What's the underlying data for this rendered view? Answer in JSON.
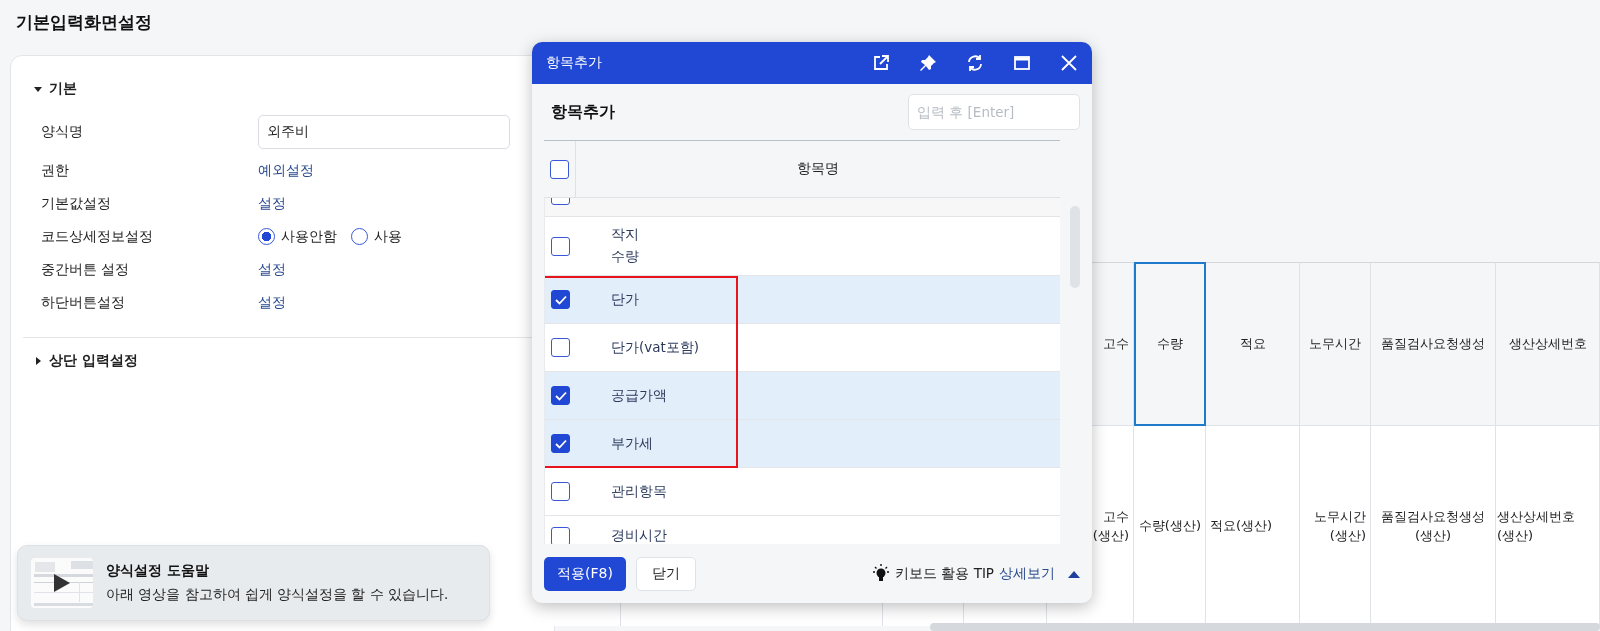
{
  "page": {
    "title": "기본입력화면설정"
  },
  "settings": {
    "sections": [
      {
        "label": "기본",
        "expanded": true,
        "rows": [
          {
            "kind": "input",
            "label": "양식명",
            "value": "외주비"
          },
          {
            "kind": "link",
            "label": "권한",
            "value": "예외설정"
          },
          {
            "kind": "link",
            "label": "기본값설정",
            "value": "설정"
          },
          {
            "kind": "radio",
            "label": "코드상세정보설정",
            "options": [
              {
                "label": "사용안함",
                "selected": true
              },
              {
                "label": "사용",
                "selected": false
              }
            ]
          },
          {
            "kind": "link",
            "label": "중간버튼 설정",
            "value": "설정"
          },
          {
            "kind": "link",
            "label": "하단버튼설정",
            "value": "설정"
          }
        ]
      },
      {
        "label": "상단 입력설정",
        "expanded": false
      }
    ]
  },
  "help": {
    "title": "양식설정 도움말",
    "text": "아래 영상을 참고하여 쉽게 양식설정을 할 수 있습니다."
  },
  "grid": {
    "columns": [
      {
        "label": "고수",
        "selected": false
      },
      {
        "label": "수량",
        "selected": true
      },
      {
        "label": "적요",
        "selected": false
      },
      {
        "label": "노무시간",
        "selected": false
      },
      {
        "label": "품질검사요청생성",
        "selected": false
      },
      {
        "label": "생산상세번호",
        "selected": false
      }
    ],
    "rows": [
      [
        "고수\n(생산)",
        "수량(생산)",
        "적요(생산)",
        "노무시간\n(생산)",
        "품질검사요청생성(생산)",
        "생산상세번호\n(생산)"
      ]
    ]
  },
  "dialog": {
    "title": "항목추가",
    "heading": "항목추가",
    "search": {
      "placeholder": "입력 후 [Enter]"
    },
    "header": {
      "label": "항목명",
      "checked": false
    },
    "clipped_row": {
      "checked": false
    },
    "items": [
      {
        "kind": "item",
        "label": "작지\n수량",
        "checked": false
      },
      {
        "kind": "group",
        "highlighted": true,
        "children": [
          {
            "kind": "item",
            "label": "단가",
            "checked": true
          },
          {
            "kind": "item",
            "label": "단가(vat포함)",
            "checked": false
          },
          {
            "kind": "item",
            "label": "공급가액",
            "checked": true
          },
          {
            "kind": "item",
            "label": "부가세",
            "checked": true
          }
        ]
      },
      {
        "kind": "item",
        "label": "관리항목",
        "checked": false
      },
      {
        "kind": "item",
        "label": "경비시간",
        "checked": false
      }
    ],
    "apply": "적용(F8)",
    "close": "닫기",
    "tip": {
      "label": "키보드 활용 TIP",
      "link": "상세보기",
      "expanded": true
    }
  }
}
